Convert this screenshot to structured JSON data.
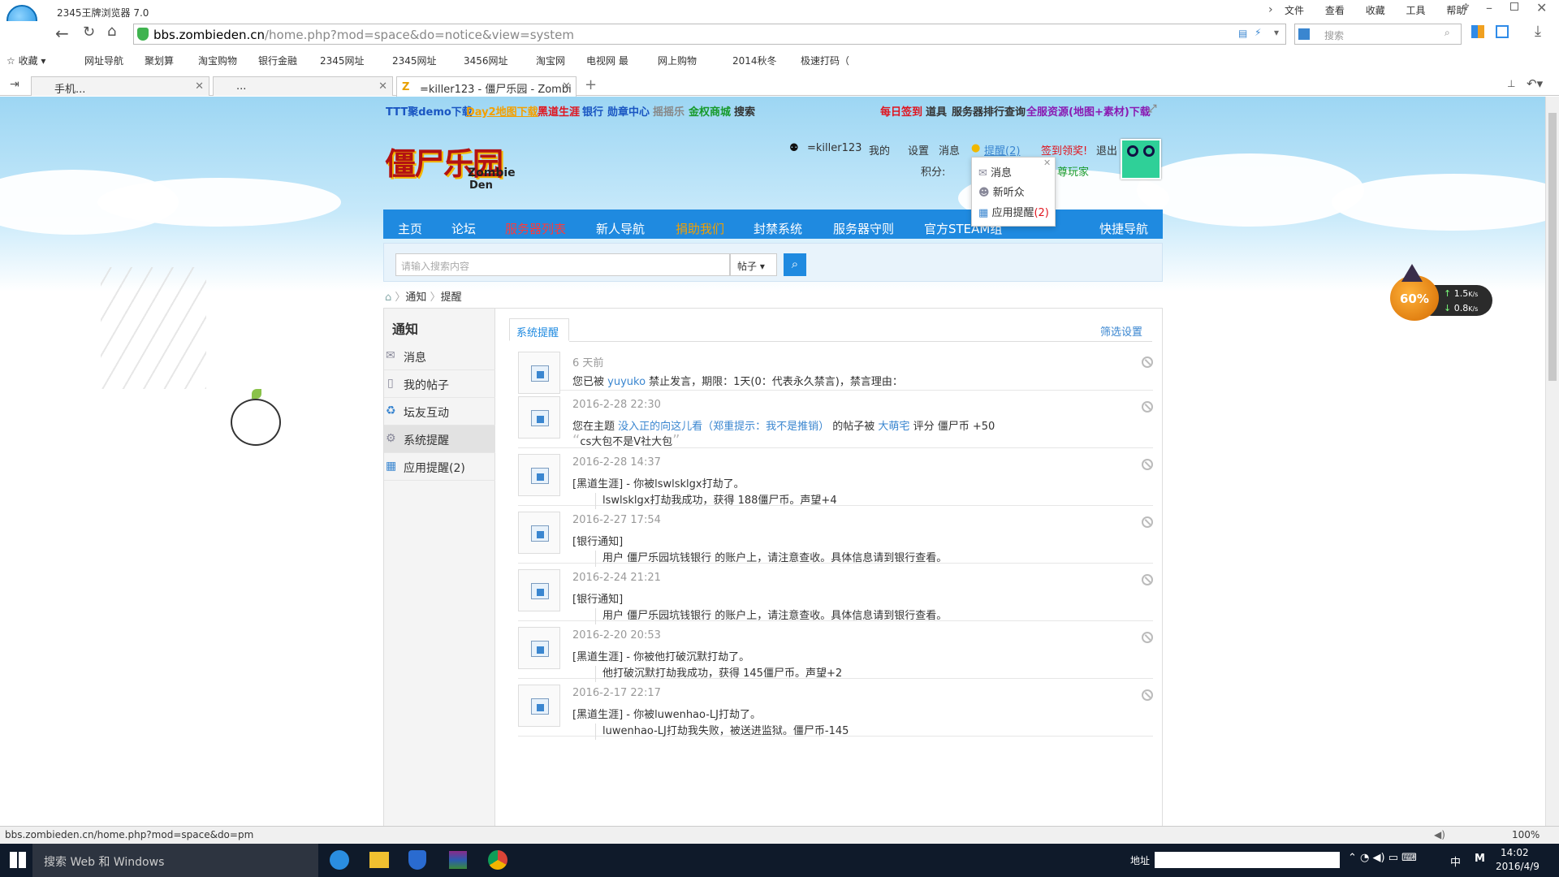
{
  "browser": {
    "title": "2345王牌浏览器 7.0",
    "menu": [
      "文件",
      "查看",
      "收藏",
      "工具",
      "帮助"
    ],
    "url_domain": "bbs.zombieden.cn",
    "url_path": "/home.php?mod=space&do=notice&view=system",
    "search_placeholder": "搜索",
    "bookmarks": [
      "收藏",
      "网址导航",
      "聚划算",
      "淘宝购物",
      "银行金融",
      "2345网址",
      "2345网址",
      "3456网址",
      "淘宝网",
      "电视网 最",
      "网上购物",
      "2014秋冬",
      "极速打码（"
    ],
    "tabs": [
      {
        "label": "手机..."
      },
      {
        "label": "..."
      },
      {
        "label": "=killer123 - 僵尸乐园 - Zombi"
      }
    ],
    "status_url": "bbs.zombieden.cn/home.php?mod=space&do=pm",
    "zoom": "100%"
  },
  "site": {
    "topstrip": {
      "left": [
        "TTT聚demo下载",
        "Day2地图下载",
        "黑道生涯",
        "银行",
        "勋章中心",
        "摇摇乐",
        "金权商城",
        "搜索"
      ],
      "right": [
        "每日签到",
        "道具",
        "服务器排行查询",
        "全服资源(地图+素材)下载"
      ]
    },
    "logo_text": "僵尸乐园",
    "logo_sub1": "Zombie",
    "logo_sub2": "Den",
    "user": {
      "name": "=killer123",
      "my": "我的",
      "settings": "设置",
      "messages": "消息",
      "remind": "提醒(2)",
      "signin": "签到领奖!",
      "logout": "退出",
      "points_label": "积分:",
      "rank": "尊玩家"
    },
    "dropdown": {
      "items": [
        {
          "label": "消息"
        },
        {
          "label": "新听众"
        },
        {
          "label": "应用提醒",
          "count": "(2)"
        }
      ]
    },
    "nav": [
      "主页",
      "论坛",
      "服务器列表",
      "新人导航",
      "捐助我们",
      "封禁系统",
      "服务器守则",
      "官方STEAM组",
      "快捷导航"
    ],
    "search": {
      "placeholder": "请输入搜索内容",
      "scope": "帖子"
    },
    "breadcrumb": [
      "通知",
      "提醒"
    ],
    "sidebar": {
      "title": "通知",
      "items": [
        "消息",
        "我的帖子",
        "坛友互动",
        "系统提醒",
        "应用提醒(2)"
      ]
    },
    "tab_active": "系统提醒",
    "filter": "筛选设置",
    "notices": [
      {
        "time": "6 天前",
        "pre": "您已被 ",
        "link": "yuyuko",
        "post": " 禁止发言，期限：1天(0：代表永久禁言)，禁言理由：",
        "quote": ""
      },
      {
        "time": "2016-2-28 22:30",
        "pre": "您在主题 ",
        "link": "没入正的向这儿看（郑重提示：我不是推销）",
        "post": " 的帖子被 ",
        "link2": "大萌宅",
        "post2": " 评分 僵尸币 +50",
        "quote": "cs大包不是V社大包"
      },
      {
        "time": "2016-2-28 14:37",
        "pre": "[黑道生涯] - 你被lswlsklgx打劫了。",
        "quote": "lswlsklgx打劫我成功，获得 188僵尸币。声望+4"
      },
      {
        "time": "2016-2-27 17:54",
        "pre": "[银行通知]",
        "quote": "用户              僵尸乐园坑钱银行 的账户上，请注意查收。具体信息请到银行查看。"
      },
      {
        "time": "2016-2-24 21:21",
        "pre": "[银行通知]",
        "quote": "用户              僵尸乐园坑钱银行 的账户上，请注意查收。具体信息请到银行查看。"
      },
      {
        "time": "2016-2-20 20:53",
        "pre": "[黑道生涯] - 你被他打破沉默打劫了。",
        "quote": "他打破沉默打劫我成功，获得 145僵尸币。声望+2"
      },
      {
        "time": "2016-2-17 22:17",
        "pre": "[黑道生涯] - 你被luwenhao-LJ打劫了。",
        "quote": "luwenhao-LJ打劫我失败，被送进监狱。僵尸币-145"
      }
    ],
    "net_widget": {
      "percent": "60%",
      "up": "1.5",
      "down": "0.8",
      "unit": "K/s"
    }
  },
  "taskbar": {
    "search_placeholder": "搜索 Web 和 Windows",
    "address_label": "地址",
    "ime": "中",
    "time": "14:02",
    "date": "2016/4/9"
  }
}
